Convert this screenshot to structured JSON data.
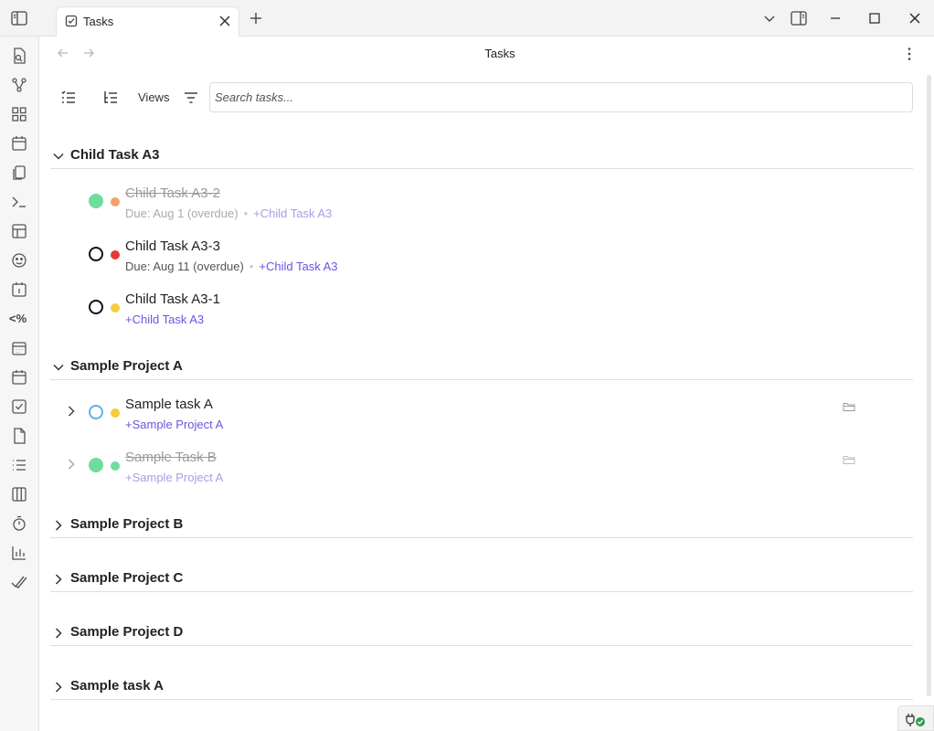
{
  "tab": {
    "title": "Tasks"
  },
  "view": {
    "title": "Tasks"
  },
  "toolbar": {
    "views_label": "Views"
  },
  "search": {
    "placeholder": "Search tasks..."
  },
  "ribbon": {
    "templater_label": "<%"
  },
  "groups": [
    {
      "title": "Child Task A3",
      "expanded": true,
      "tasks": [
        {
          "title": "Child Task A3-2",
          "completed": true,
          "status": "done",
          "priority_color": "#f0a070",
          "due": "Due: Aug 1 (overdue)",
          "project": "+Child Task A3"
        },
        {
          "title": "Child Task A3-3",
          "completed": false,
          "status": "open",
          "priority_color": "#e53935",
          "due": "Due: Aug 11 (overdue)",
          "project": "+Child Task A3"
        },
        {
          "title": "Child Task A3-1",
          "completed": false,
          "status": "open",
          "priority_color": "#f5cc3d",
          "due": "",
          "project": "+Child Task A3"
        }
      ]
    },
    {
      "title": "Sample Project A",
      "expanded": true,
      "tasks": [
        {
          "title": "Sample task A",
          "completed": false,
          "status": "in-progress",
          "priority_color": "#f5cc3d",
          "project": "+Sample Project A"
        },
        {
          "title": "Sample Task B",
          "completed": true,
          "status": "done",
          "priority_color": "#6fdc9b",
          "project": "+Sample Project A"
        }
      ]
    },
    {
      "title": "Sample Project B",
      "expanded": false
    },
    {
      "title": "Sample Project C",
      "expanded": false
    },
    {
      "title": "Sample Project D",
      "expanded": false
    },
    {
      "title": "Sample task A",
      "expanded": false
    }
  ],
  "colors": {
    "accent": "#6b55e0",
    "done": "#6fdc9b",
    "in_progress": "#5bb3e6"
  }
}
